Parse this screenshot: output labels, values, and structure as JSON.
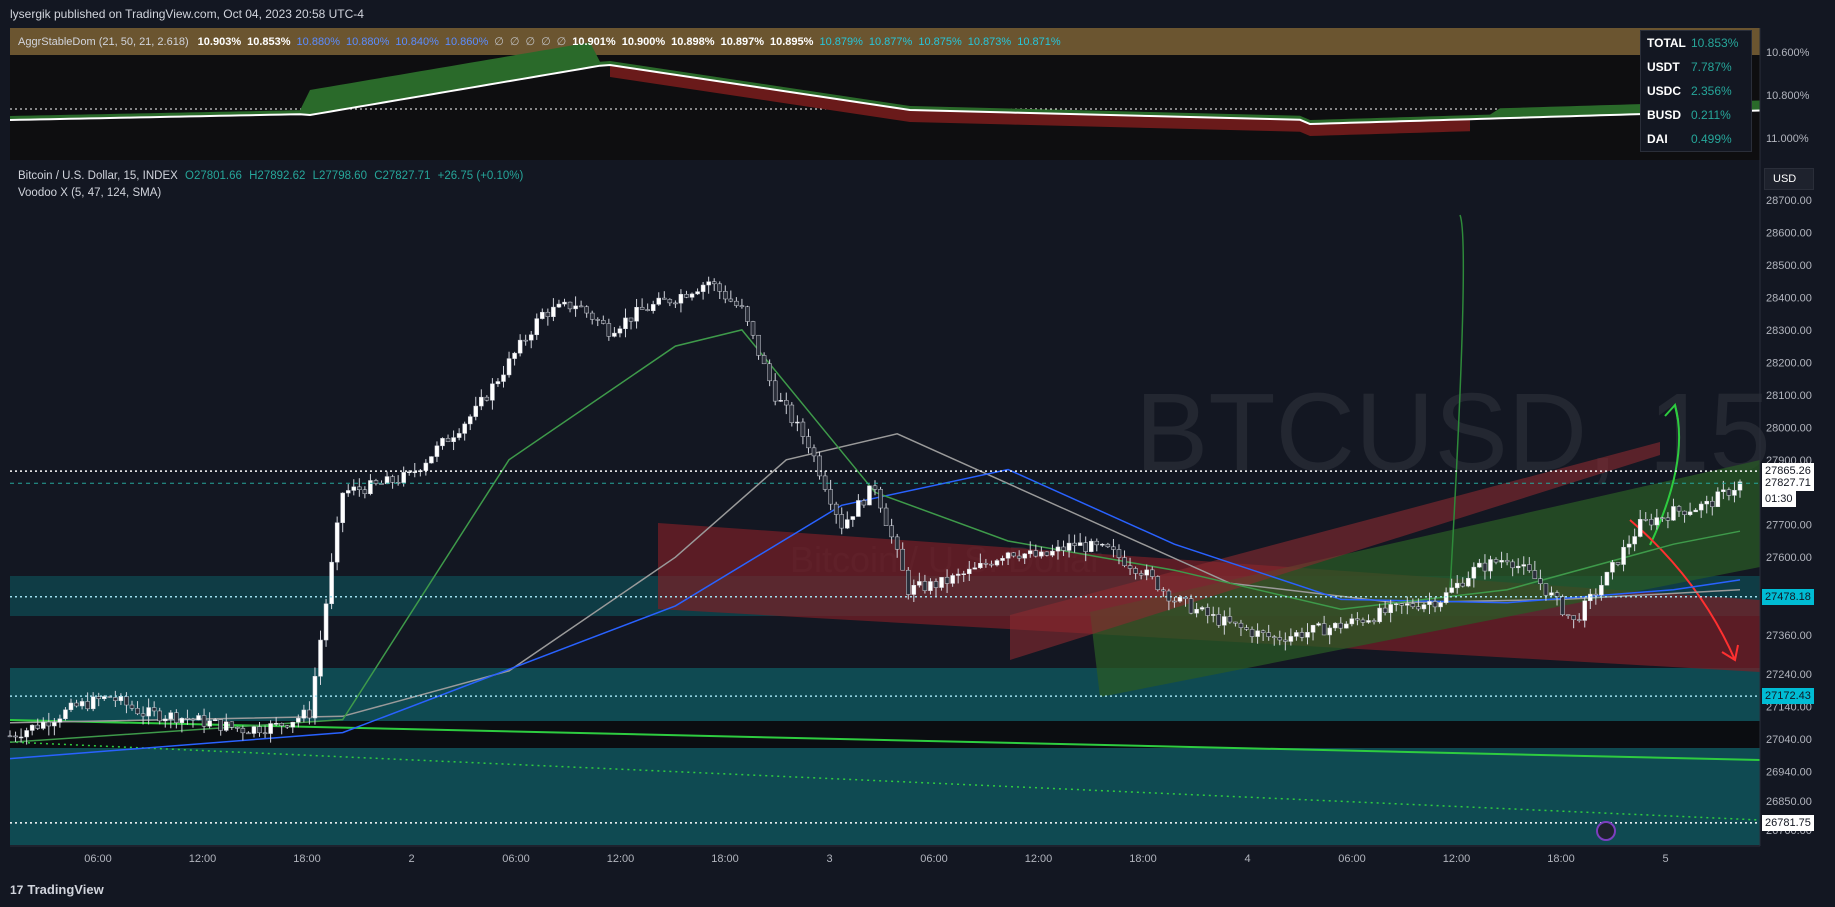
{
  "header": {
    "publish_text": "lysergik published on TradingView.com, Oct 04, 2023 20:58 UTC-4"
  },
  "indicator": {
    "name": "AggrStableDom (21, 50, 21, 2.618)",
    "values": [
      "10.903%",
      "10.853%",
      "10.880%",
      "10.880%",
      "10.840%",
      "10.860%",
      "∅",
      "∅",
      "∅",
      "∅",
      "∅",
      "10.901%",
      "10.900%",
      "10.898%",
      "10.897%",
      "10.895%",
      "10.879%",
      "10.877%",
      "10.875%",
      "10.873%",
      "10.871%"
    ],
    "axis_labels": [
      "10.600%",
      "10.800%",
      "11.000%"
    ]
  },
  "stable_table": [
    {
      "k": "TOTAL",
      "v": "10.853%"
    },
    {
      "k": "USDT",
      "v": "7.787%"
    },
    {
      "k": "USDC",
      "v": "2.356%"
    },
    {
      "k": "BUSD",
      "v": "0.211%"
    },
    {
      "k": "DAI",
      "v": "0.499%"
    }
  ],
  "main_legend": {
    "symbol": "Bitcoin / U.S. Dollar, 15, INDEX",
    "open": "O27801.66",
    "high": "H27892.62",
    "low": "L27798.60",
    "close": "C27827.71",
    "change": "+26.75 (+0.10%)",
    "indicator2": "Voodoo X (5, 47, 124, SMA)"
  },
  "watermark": {
    "top": "BTCUSD, 15",
    "bottom": "Bitcoin / U.S. Dollar"
  },
  "currency_button": "USD",
  "price_labels": {
    "p27865": "27865.26",
    "p27827": "27827.71",
    "timer": "01:30",
    "p27478": "27478.18",
    "p27172": "27172.43",
    "p26781": "26781.75"
  },
  "footer": {
    "logo": "TradingView"
  },
  "chart_data": {
    "type": "candlestick",
    "title": "Bitcoin / U.S. Dollar, 15, INDEX",
    "yaxis_ticks": [
      28700,
      28600,
      28500,
      28400,
      28300,
      28200,
      28100,
      28000,
      27900,
      27700,
      27600,
      27480,
      27360,
      27240,
      27140,
      27040,
      26940,
      26850,
      26760
    ],
    "yaxis_tick_labels": [
      "28700.00",
      "28600.00",
      "28500.00",
      "28400.00",
      "28300.00",
      "28200.00",
      "28100.00",
      "28000.00",
      "27900.00",
      "27700.00",
      "27600.00",
      "27480.00",
      "27360.00",
      "27240.00",
      "27140.00",
      "27040.00",
      "26940.00",
      "26850.00",
      "26760.00"
    ],
    "ylim": [
      26760,
      28700
    ],
    "xaxis_ticks": [
      "06:00",
      "12:00",
      "18:00",
      "2",
      "06:00",
      "12:00",
      "18:00",
      "3",
      "06:00",
      "12:00",
      "18:00",
      "4",
      "06:00",
      "12:00",
      "18:00",
      "5"
    ],
    "close_path": [
      [
        0,
        27050
      ],
      [
        3,
        27090
      ],
      [
        6,
        27140
      ],
      [
        9,
        27170
      ],
      [
        12,
        27120
      ],
      [
        15,
        27110
      ],
      [
        18,
        27090
      ],
      [
        21,
        27070
      ],
      [
        24,
        27080
      ],
      [
        27,
        27120
      ],
      [
        30,
        27800
      ],
      [
        33,
        27820
      ],
      [
        36,
        27850
      ],
      [
        39,
        27950
      ],
      [
        42,
        28050
      ],
      [
        45,
        28200
      ],
      [
        48,
        28350
      ],
      [
        51,
        28380
      ],
      [
        54,
        28300
      ],
      [
        57,
        28360
      ],
      [
        60,
        28400
      ],
      [
        63,
        28450
      ],
      [
        66,
        28360
      ],
      [
        69,
        28100
      ],
      [
        72,
        27950
      ],
      [
        75,
        27700
      ],
      [
        78,
        27820
      ],
      [
        81,
        27500
      ],
      [
        84,
        27520
      ],
      [
        87,
        27560
      ],
      [
        90,
        27620
      ],
      [
        93,
        27600
      ],
      [
        96,
        27640
      ],
      [
        99,
        27620
      ],
      [
        102,
        27560
      ],
      [
        105,
        27470
      ],
      [
        108,
        27420
      ],
      [
        111,
        27380
      ],
      [
        114,
        27350
      ],
      [
        117,
        27370
      ],
      [
        120,
        27390
      ],
      [
        123,
        27420
      ],
      [
        126,
        27450
      ],
      [
        129,
        27470
      ],
      [
        132,
        27560
      ],
      [
        135,
        27600
      ],
      [
        138,
        27520
      ],
      [
        141,
        27400
      ],
      [
        144,
        27540
      ],
      [
        147,
        27700
      ],
      [
        150,
        27740
      ],
      [
        153,
        27760
      ],
      [
        156,
        27827
      ]
    ],
    "levels": [
      27865.26,
      27827.71,
      27478.18,
      27172.43,
      26781.75
    ],
    "ema_fast_path": [
      [
        0,
        27030
      ],
      [
        30,
        27100
      ],
      [
        45,
        27900
      ],
      [
        60,
        28250
      ],
      [
        66,
        28300
      ],
      [
        78,
        27800
      ],
      [
        90,
        27650
      ],
      [
        105,
        27560
      ],
      [
        120,
        27440
      ],
      [
        135,
        27500
      ],
      [
        150,
        27640
      ],
      [
        156,
        27680
      ]
    ],
    "ema_slow_path": [
      [
        0,
        26980
      ],
      [
        30,
        27060
      ],
      [
        60,
        27450
      ],
      [
        75,
        27760
      ],
      [
        90,
        27870
      ],
      [
        105,
        27640
      ],
      [
        120,
        27470
      ],
      [
        135,
        27460
      ],
      [
        150,
        27500
      ],
      [
        156,
        27530
      ]
    ],
    "sma_slow_path": [
      [
        0,
        27090
      ],
      [
        30,
        27110
      ],
      [
        45,
        27250
      ],
      [
        60,
        27600
      ],
      [
        70,
        27900
      ],
      [
        80,
        27980
      ],
      [
        95,
        27750
      ],
      [
        110,
        27520
      ],
      [
        125,
        27460
      ],
      [
        140,
        27470
      ],
      [
        156,
        27500
      ]
    ]
  }
}
